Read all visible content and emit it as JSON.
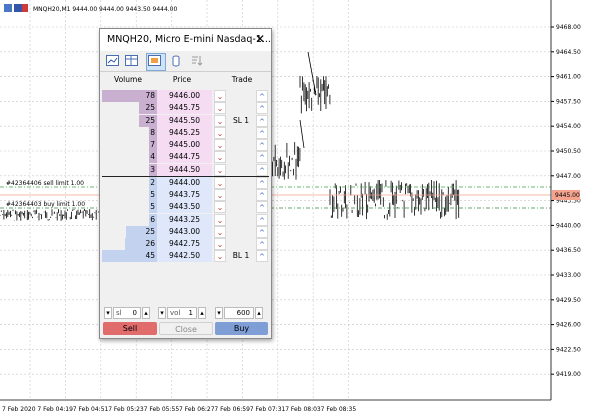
{
  "window_title": "MNQH20,M1  9444.00 9444.00 9443.50 9444.00",
  "price_axis": [
    "9468.00",
    "9464.50",
    "9461.00",
    "9457.50",
    "9454.00",
    "9450.50",
    "9447.00",
    "9443.50",
    "9440.00",
    "9436.50",
    "9433.00",
    "9429.50",
    "9426.00",
    "9422.50",
    "9419.00"
  ],
  "current_price_tag": "9445.00",
  "time_axis": [
    "7 Feb 2020",
    "7 Feb 04:19",
    "7 Feb 04:51",
    "7 Feb 05:23",
    "7 Feb 05:55",
    "7 Feb 06:27",
    "7 Feb 06:59",
    "7 Feb 07:31",
    "7 Feb 08:03",
    "7 Feb 08:35"
  ],
  "orders": {
    "sell": "#42364406 sell limit 1.00",
    "buy": "#42364403 buy limit 1.00"
  },
  "dom": {
    "title": "MNQH20, Micro E-mini Nasdaq-1...",
    "close": "✕",
    "headers": {
      "volume": "Volume",
      "price": "Price",
      "trade": "Trade"
    },
    "ask_rows": [
      {
        "volume": "78",
        "price": "9446.00",
        "trade": ""
      },
      {
        "volume": "25",
        "price": "9445.75",
        "trade": ""
      },
      {
        "volume": "25",
        "price": "9445.50",
        "trade": "SL 1"
      },
      {
        "volume": "8",
        "price": "9445.25",
        "trade": ""
      },
      {
        "volume": "7",
        "price": "9445.00",
        "trade": ""
      },
      {
        "volume": "4",
        "price": "9444.75",
        "trade": ""
      },
      {
        "volume": "3",
        "price": "9444.50",
        "trade": ""
      }
    ],
    "bid_rows": [
      {
        "volume": "2",
        "price": "9444.00",
        "trade": ""
      },
      {
        "volume": "5",
        "price": "9443.75",
        "trade": ""
      },
      {
        "volume": "5",
        "price": "9443.50",
        "trade": ""
      },
      {
        "volume": "6",
        "price": "9443.25",
        "trade": ""
      },
      {
        "volume": "25",
        "price": "9443.00",
        "trade": ""
      },
      {
        "volume": "26",
        "price": "9442.75",
        "trade": ""
      },
      {
        "volume": "45",
        "price": "9442.50",
        "trade": "BL 1"
      }
    ],
    "sl": {
      "label": "sl",
      "value": "0"
    },
    "vol": {
      "label": "vol",
      "value": "1"
    },
    "tp": {
      "value": "600"
    },
    "sell_label": "Sell",
    "close_label": "Close",
    "buy_label": "Buy"
  },
  "colors": {
    "ask_bar": "#c9afd0",
    "ask_price_bg": "#f6dcf3",
    "bid_bar": "#c3d2ef",
    "bid_price_bg": "#dfe8fb",
    "sell_btn": "#e06c6c",
    "buy_btn": "#7f9ed6",
    "sell_line": "#3aa84a",
    "buy_line": "#2e8b3e"
  }
}
